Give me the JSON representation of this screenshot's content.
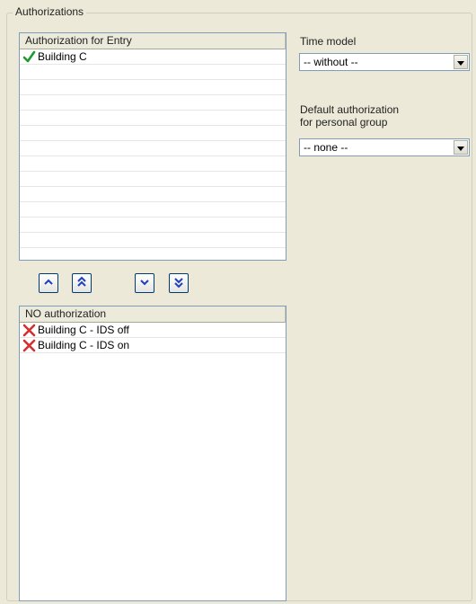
{
  "group": {
    "title": "Authorizations"
  },
  "authorized_list": {
    "header": "Authorization for Entry",
    "items": [
      {
        "label": "Building C",
        "icon": "checkmark-icon"
      }
    ]
  },
  "move_buttons": [
    {
      "name": "move-up-button",
      "icon": "chevron-up-icon"
    },
    {
      "name": "move-all-up-button",
      "icon": "double-chevron-up-icon"
    },
    {
      "name": "move-down-button",
      "icon": "chevron-down-icon"
    },
    {
      "name": "move-all-down-button",
      "icon": "double-chevron-down-icon"
    }
  ],
  "unauthorized_list": {
    "header": "NO authorization",
    "items": [
      {
        "label": "Building C - IDS off",
        "icon": "x-mark-icon"
      },
      {
        "label": "Building C - IDS on",
        "icon": "x-mark-icon"
      }
    ]
  },
  "time_model": {
    "label": "Time model",
    "value": "-- without --"
  },
  "default_authorization": {
    "label_line1": "Default authorization",
    "label_line2": "for personal group",
    "value": "-- none --"
  },
  "colors": {
    "button_arrow": "#1e3fbf",
    "check": "#1f9a2f",
    "cross": "#d43030",
    "background": "#ece9d8"
  }
}
